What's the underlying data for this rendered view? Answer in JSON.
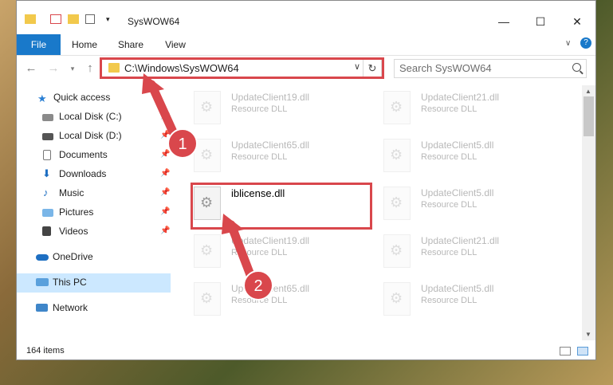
{
  "window": {
    "title": "SysWOW64"
  },
  "ribbon": {
    "tabs": [
      "File",
      "Home",
      "Share",
      "View"
    ]
  },
  "address": {
    "path": "C:\\Windows\\SysWOW64"
  },
  "search": {
    "placeholder": "Search SysWOW64"
  },
  "sidebar": {
    "items": [
      {
        "label": "Quick access"
      },
      {
        "label": "Local Disk (C:)"
      },
      {
        "label": "Local Disk (D:)"
      },
      {
        "label": "Documents"
      },
      {
        "label": "Downloads"
      },
      {
        "label": "Music"
      },
      {
        "label": "Pictures"
      },
      {
        "label": "Videos"
      },
      {
        "label": "OneDrive"
      },
      {
        "label": "This PC"
      },
      {
        "label": "Network"
      }
    ]
  },
  "files": [
    {
      "name": "UpdateClient19.dll",
      "type": "Resource DLL"
    },
    {
      "name": "UpdateClient21.dll",
      "type": "Resource DLL"
    },
    {
      "name": "UpdateClient65.dll",
      "type": "Resource DLL"
    },
    {
      "name": "UpdateClient5.dll",
      "type": "Resource DLL"
    },
    {
      "name": "iblicense.dll",
      "type": ""
    },
    {
      "name": "UpdateClient5.dll",
      "type": "Resource DLL"
    },
    {
      "name": "UpdateClient19.dll",
      "type": "Resource DLL"
    },
    {
      "name": "UpdateClient21.dll",
      "type": "Resource DLL"
    },
    {
      "name": "UpdateClient65.dll",
      "type": "Resource DLL"
    },
    {
      "name": "UpdateClient5.dll",
      "type": "Resource DLL"
    }
  ],
  "status": {
    "item_count": "164 items"
  },
  "callouts": {
    "one": "1",
    "two": "2"
  },
  "colors": {
    "accent": "#1979ca",
    "callout_red": "#d9474c",
    "selected_bg": "#cce8ff"
  }
}
